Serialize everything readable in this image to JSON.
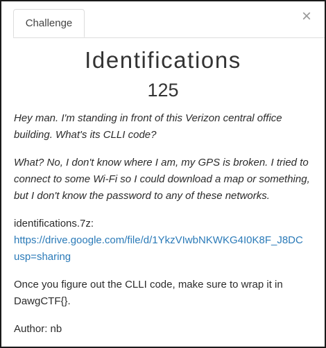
{
  "tabs": [
    {
      "label": "Challenge"
    }
  ],
  "close_glyph": "×",
  "challenge": {
    "name": "Identifications",
    "points": "125",
    "description_line1": "Hey man. I'm standing in front of this Verizon central office building. What's its CLLI code?",
    "description_line2": "What? No, I don't know where I am, my GPS is broken. I tried to connect to some Wi-Fi so I could download a map or something, but I don't know the password to any of these networks.",
    "file_label": "identifications.7z:",
    "file_url_part1": "https://drive.google.com/file/d/1YkzVIwbNKWKG4I0K8F_J8DC",
    "file_url_part2": "usp=sharing",
    "wrap_instruction": "Once you figure out the CLLI code, make sure to wrap it in DawgCTF{}.",
    "author": "Author: nb"
  },
  "icons": {
    "close": "close-icon"
  }
}
